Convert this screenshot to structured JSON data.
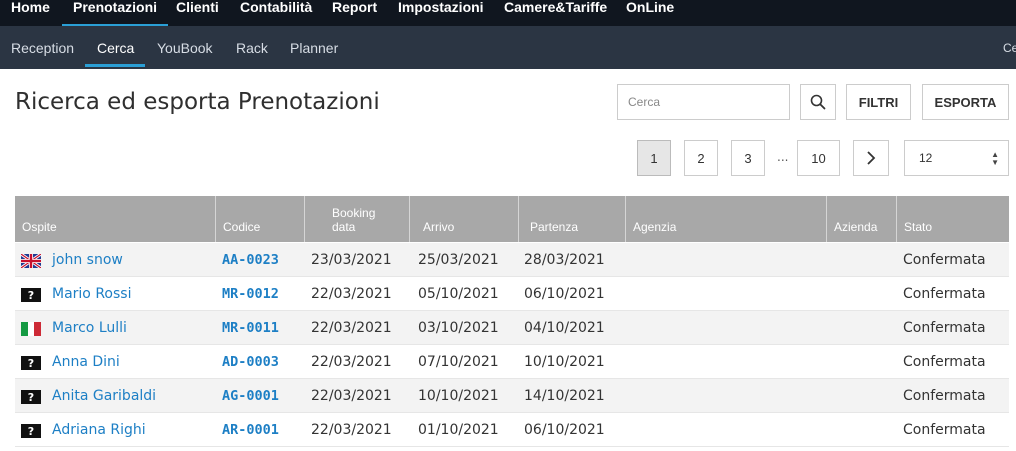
{
  "topnav": {
    "items": [
      {
        "label": "Home"
      },
      {
        "label": "Prenotazioni"
      },
      {
        "label": "Clienti"
      },
      {
        "label": "Contabilità"
      },
      {
        "label": "Report"
      },
      {
        "label": "Impostazioni"
      },
      {
        "label": "Camere&Tariffe"
      },
      {
        "label": "OnLine"
      }
    ],
    "active": "Prenotazioni"
  },
  "subnav": {
    "items": [
      {
        "label": "Reception"
      },
      {
        "label": "Cerca"
      },
      {
        "label": "YouBook"
      },
      {
        "label": "Rack"
      },
      {
        "label": "Planner"
      }
    ],
    "active": "Cerca",
    "right_text": "Ce"
  },
  "page": {
    "title": "Ricerca ed esporta Prenotazioni",
    "search_placeholder": "Cerca",
    "filtri_label": "FILTRI",
    "esporta_label": "ESPORTA"
  },
  "pagination": {
    "pages": [
      "1",
      "2",
      "3",
      "10"
    ],
    "ellipsis": "...",
    "current": "1",
    "next_icon": "chevron-right-icon",
    "per_page": "12"
  },
  "table": {
    "headers": [
      "Ospite",
      "Codice",
      "Booking data",
      "Arrivo",
      "Partenza",
      "Agenzia",
      "Azienda",
      "Stato"
    ],
    "rows": [
      {
        "flag": "uk-flag-icon",
        "guest": "john snow",
        "code": "AA-0023",
        "booking": "23/03/2021",
        "arrival": "25/03/2021",
        "departure": "28/03/2021",
        "agency": "",
        "company": "",
        "status": "Confermata"
      },
      {
        "flag": "unknown-flag-icon",
        "guest": "Mario Rossi",
        "code": "MR-0012",
        "booking": "22/03/2021",
        "arrival": "05/10/2021",
        "departure": "06/10/2021",
        "agency": "",
        "company": "",
        "status": "Confermata"
      },
      {
        "flag": "italy-flag-icon",
        "guest": "Marco Lulli",
        "code": "MR-0011",
        "booking": "22/03/2021",
        "arrival": "03/10/2021",
        "departure": "04/10/2021",
        "agency": "",
        "company": "",
        "status": "Confermata"
      },
      {
        "flag": "unknown-flag-icon",
        "guest": "Anna Dini",
        "code": "AD-0003",
        "booking": "22/03/2021",
        "arrival": "07/10/2021",
        "departure": "10/10/2021",
        "agency": "",
        "company": "",
        "status": "Confermata"
      },
      {
        "flag": "unknown-flag-icon",
        "guest": "Anita Garibaldi",
        "code": "AG-0001",
        "booking": "22/03/2021",
        "arrival": "10/10/2021",
        "departure": "14/10/2021",
        "agency": "",
        "company": "",
        "status": "Confermata"
      },
      {
        "flag": "unknown-flag-icon",
        "guest": "Adriana Righi",
        "code": "AR-0001",
        "booking": "22/03/2021",
        "arrival": "01/10/2021",
        "departure": "06/10/2021",
        "agency": "",
        "company": "",
        "status": "Confermata"
      }
    ]
  },
  "colors": {
    "topnav_bg": "#10161f",
    "subnav_bg": "#2b3543",
    "accent": "#2a9fd6",
    "link": "#1d7fc5",
    "header_bg": "#a8a8a8"
  }
}
